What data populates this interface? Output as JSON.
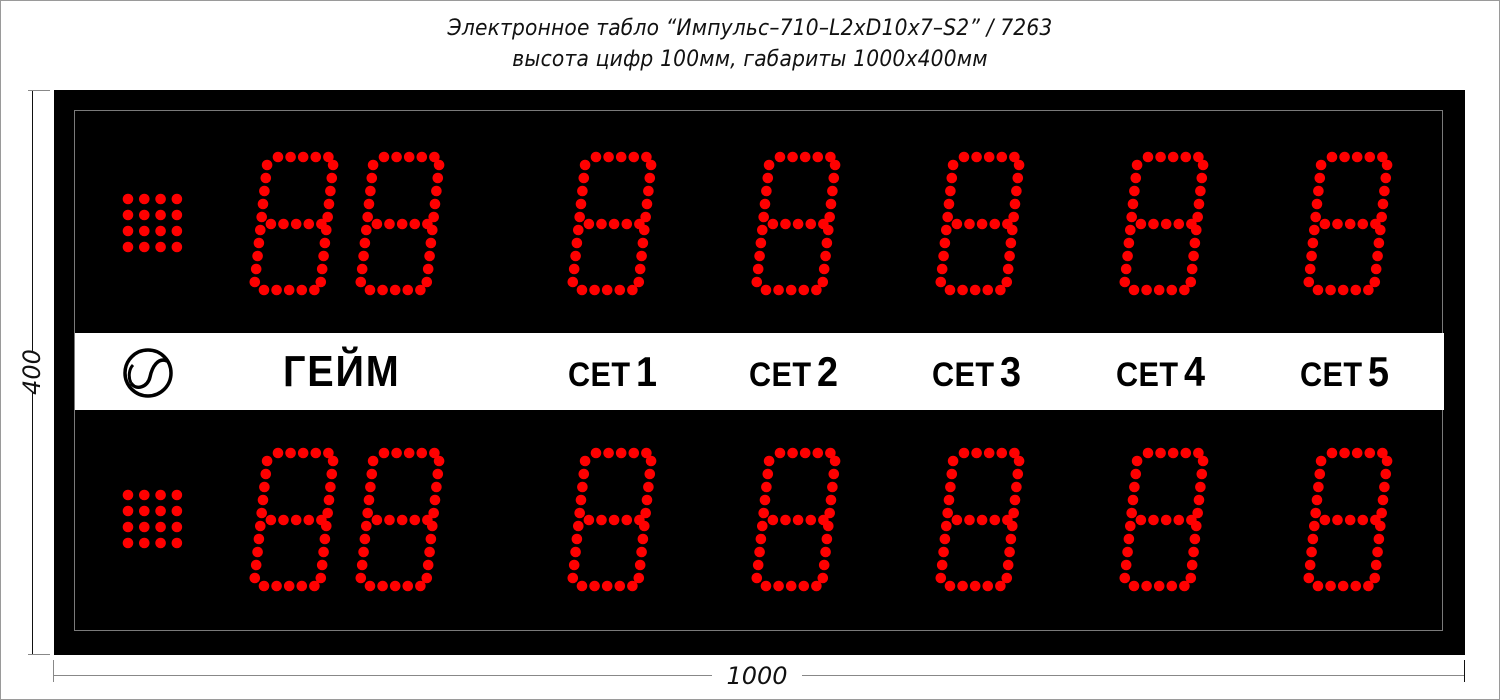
{
  "header": {
    "title_line1": "Электронное табло “Импульс–710–L2xD10x7–S2” / 7263",
    "title_line2": "высота цифр 100мм, габариты 1000x400мм"
  },
  "dimensions": {
    "height_label": "400",
    "width_label": "1000"
  },
  "scoreboard": {
    "led_color": "#FF0000",
    "panel_color": "#000000",
    "band_color": "#FFFFFF",
    "labels": {
      "serve_icon": "tennis-ball-icon",
      "game": "ГЕЙМ",
      "sets": [
        {
          "word": "СЕТ",
          "number": "1"
        },
        {
          "word": "СЕТ",
          "number": "2"
        },
        {
          "word": "СЕТ",
          "number": "3"
        },
        {
          "word": "СЕТ",
          "number": "4"
        },
        {
          "word": "СЕТ",
          "number": "5"
        }
      ]
    },
    "rows": [
      {
        "name": "player-1",
        "serve_indicator": "4x4",
        "game_digits": [
          "8",
          "8"
        ],
        "set_digits": [
          "8",
          "8",
          "8",
          "8",
          "8"
        ]
      },
      {
        "name": "player-2",
        "serve_indicator": "4x4",
        "game_digits": [
          "8",
          "8"
        ],
        "set_digits": [
          "8",
          "8",
          "8",
          "8",
          "8"
        ]
      }
    ]
  }
}
